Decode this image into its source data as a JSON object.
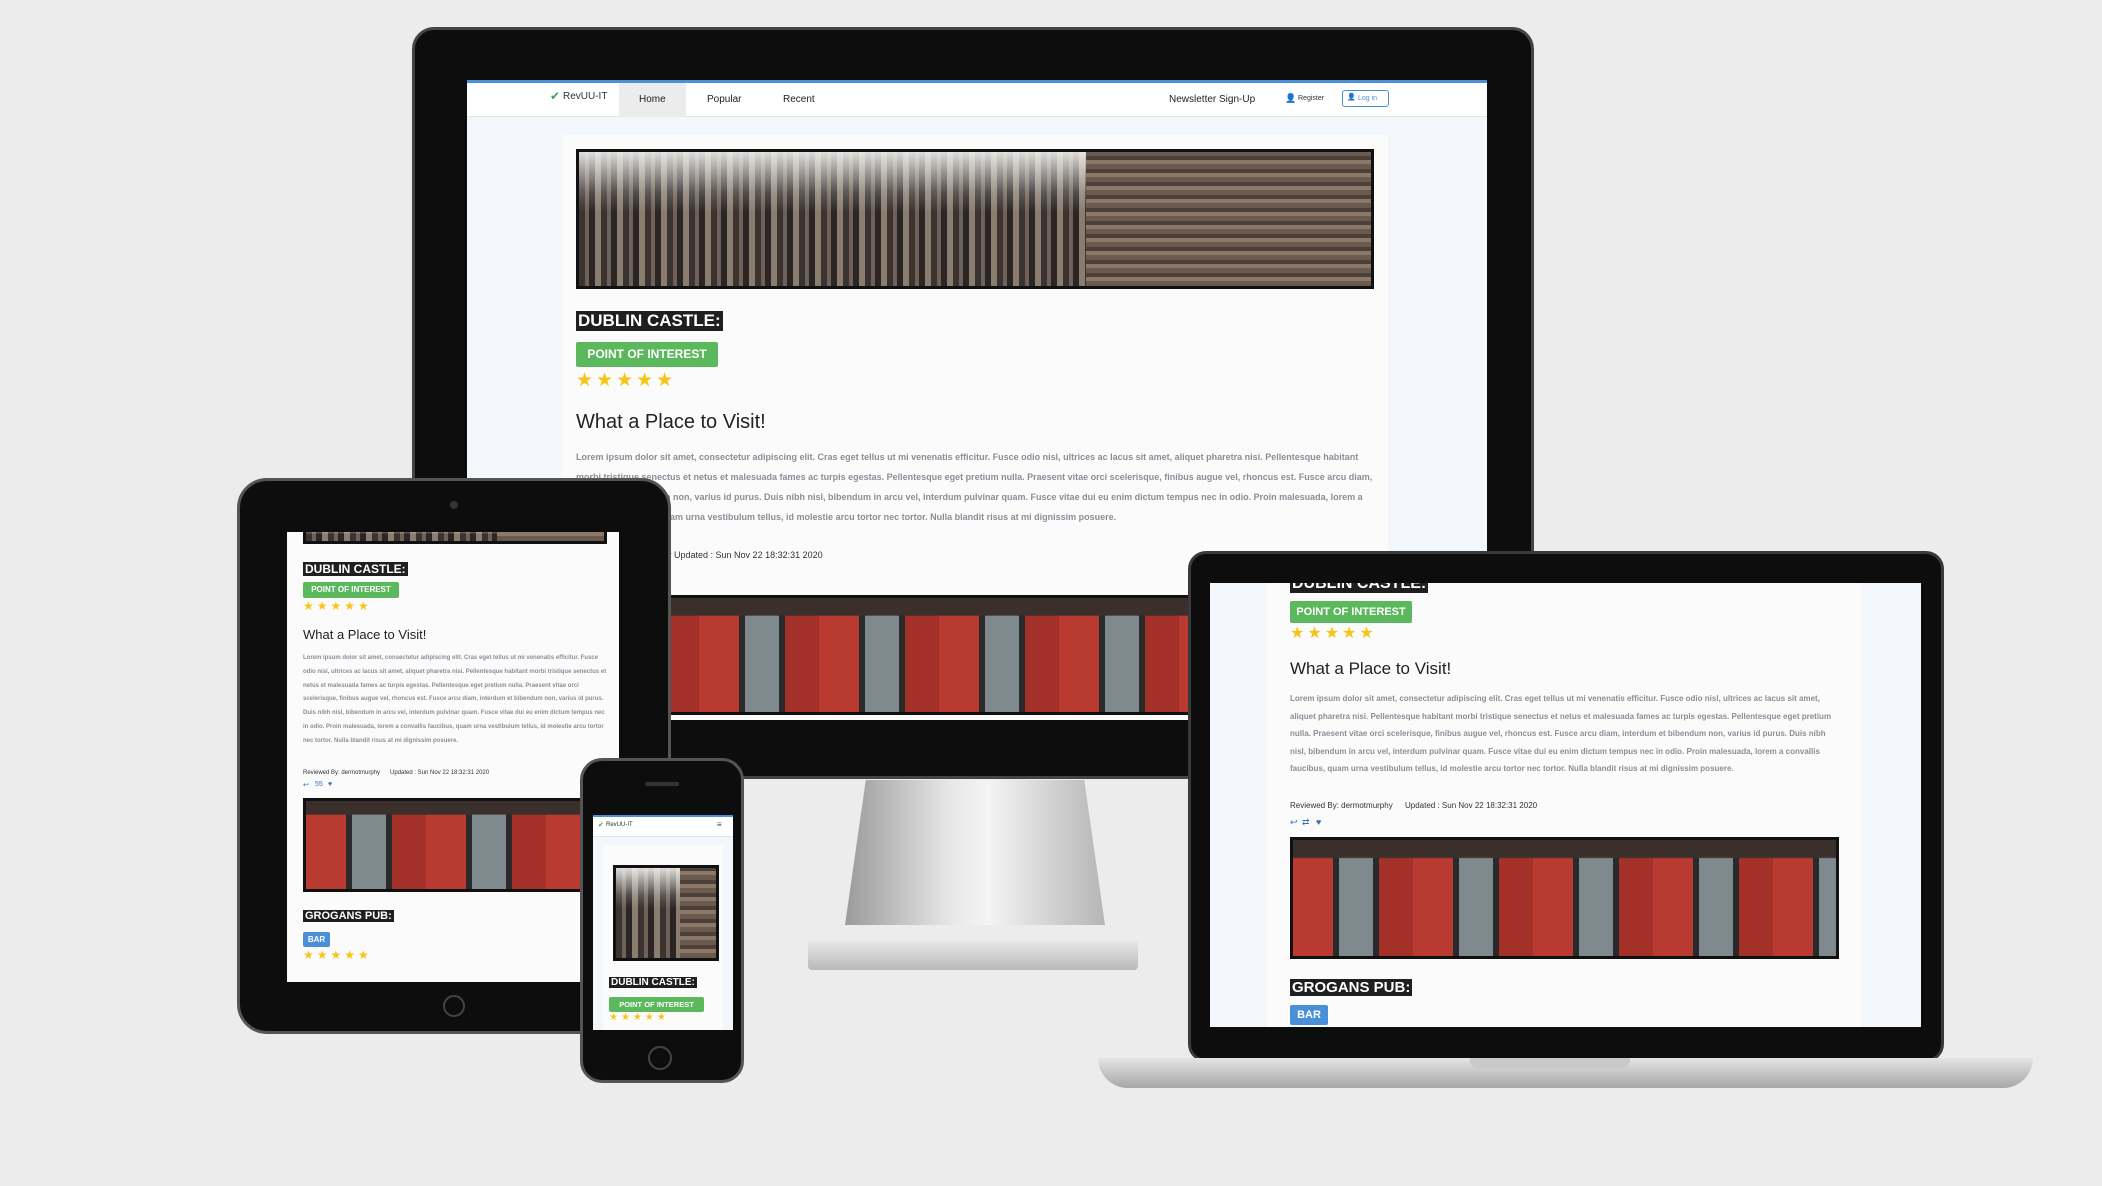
{
  "brand": {
    "name": "RevUU-IT",
    "check_icon": "check-icon"
  },
  "nav": {
    "items": [
      "Home",
      "Popular",
      "Recent"
    ],
    "newsletter": "Newsletter Sign-Up",
    "register": "Register",
    "login": "Log in"
  },
  "review1": {
    "place": "DUBLIN CASTLE:",
    "category": "POINT OF INTEREST",
    "rating": 5,
    "stars": "★★★★★",
    "title": "What a Place to Visit!",
    "body": "Lorem ipsum dolor sit amet, consectetur adipiscing elit. Cras eget tellus ut mi venenatis efficitur. Fusce odio nisl, ultrices ac lacus sit amet, aliquet pharetra nisi. Pellentesque habitant morbi tristique senectus et netus et malesuada fames ac turpis egestas. Pellentesque eget pretium nulla. Praesent vitae orci scelerisque, finibus augue vel, rhoncus est. Fusce arcu diam, interdum et bibendum non, varius id purus. Duis nibh nisl, bibendum in arcu vel, interdum pulvinar quam. Fusce vitae dui eu enim dictum tempus nec in odio. Proin malesuada, lorem a convallis faucibus, quam urna vestibulum tellus, id molestie arcu tortor nec tortor. Nulla blandit risus at mi dignissim posuere.",
    "reviewed_by": "Reviewed By: dermotmurphy",
    "updated": "Updated : Sun Nov 22 18:32:31 2020",
    "monitor_meta": "phy   Updated : Sun Nov 22 18:32:31 2020"
  },
  "review2": {
    "place": "GROGANS PUB:",
    "category": "BAR",
    "rating": 5,
    "stars": "★★★★★"
  },
  "icons": {
    "reply": "reply-icon",
    "retweet": "retweet-icon",
    "heart": "heart-icon",
    "count": "55"
  },
  "colors": {
    "accent": "#4a90d9",
    "badge_green": "#5cb85c",
    "star": "#f5c518"
  }
}
